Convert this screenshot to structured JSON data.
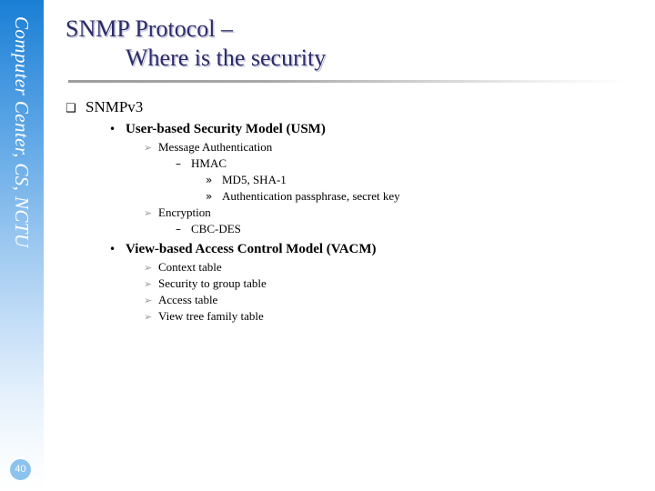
{
  "sidebar": {
    "label": "Computer Center, CS, NCTU",
    "page_number": "40",
    "gradient_top_color": "#1a7fd4",
    "gradient_bottom_color": "#ffffff",
    "badge_color": "#8cc3ee"
  },
  "title": {
    "line1": "SNMP Protocol –",
    "line2": "Where is the security",
    "color": "#2b2b68"
  },
  "bullets": {
    "l1_glyph": "❑",
    "l2_glyph": "•",
    "l3_glyph": "➢",
    "l4_glyph": "–",
    "l5_glyph": "»",
    "l3_color": "#9a9a9a"
  },
  "content": [
    {
      "level": 1,
      "text": "SNMPv3"
    },
    {
      "level": 2,
      "text": "User-based Security Model (USM)"
    },
    {
      "level": 3,
      "text": "Message Authentication"
    },
    {
      "level": 4,
      "text": "HMAC"
    },
    {
      "level": 5,
      "text": "MD5, SHA-1"
    },
    {
      "level": 5,
      "text": "Authentication passphrase, secret key"
    },
    {
      "level": 3,
      "text": "Encryption"
    },
    {
      "level": 4,
      "text": "CBC-DES"
    },
    {
      "level": 2,
      "text": "View-based Access Control Model (VACM)"
    },
    {
      "level": 3,
      "text": "Context table"
    },
    {
      "level": 3,
      "text": "Security to group table"
    },
    {
      "level": 3,
      "text": "Access table"
    },
    {
      "level": 3,
      "text": "View tree family table"
    }
  ]
}
